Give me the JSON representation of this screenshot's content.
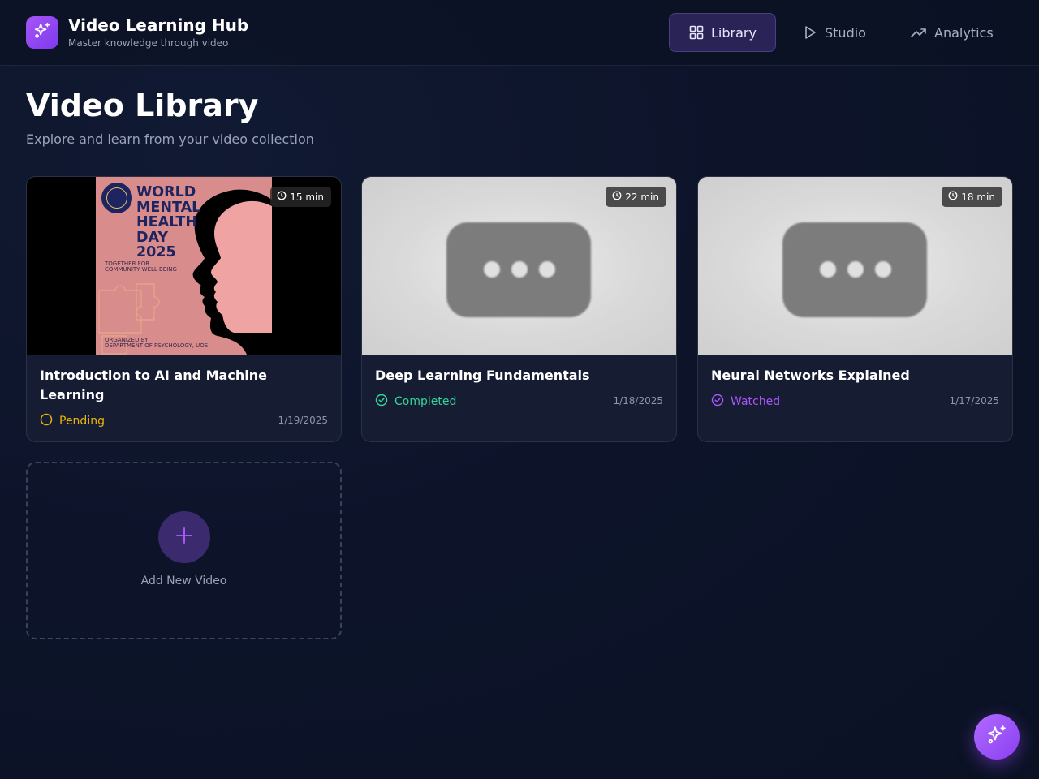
{
  "app": {
    "title": "Video Learning Hub",
    "subtitle": "Master knowledge through video",
    "logo_icon": "sparkles-icon"
  },
  "nav": [
    {
      "label": "Library",
      "icon": "grid-icon",
      "active": true
    },
    {
      "label": "Studio",
      "icon": "play-icon",
      "active": false
    },
    {
      "label": "Analytics",
      "icon": "trending-up-icon",
      "active": false
    }
  ],
  "page": {
    "title": "Video Library",
    "subtitle": "Explore and learn from your video collection"
  },
  "videos": [
    {
      "title": "Introduction to AI and Machine Learning",
      "duration": "15 min",
      "status": "Pending",
      "status_color": "#eab308",
      "date": "1/19/2025",
      "thumbnail": {
        "kind": "poster",
        "lines": [
          "WORLD",
          "MENTAL",
          "HEALTH",
          "DAY",
          "2025"
        ],
        "tagline": [
          "TOGETHER FOR",
          "COMMUNITY WELL-BEING"
        ],
        "organizer": [
          "ORGANIZED BY",
          "DEPARTMENT OF PSYCHOLOGY, UOS"
        ]
      }
    },
    {
      "title": "Deep Learning Fundamentals",
      "duration": "22 min",
      "status": "Completed",
      "status_color": "#34d399",
      "date": "1/18/2025",
      "thumbnail": {
        "kind": "placeholder"
      }
    },
    {
      "title": "Neural Networks Explained",
      "duration": "18 min",
      "status": "Watched",
      "status_color": "#a855f7",
      "date": "1/17/2025",
      "thumbnail": {
        "kind": "placeholder"
      }
    }
  ],
  "add_card": {
    "label": "Add New Video",
    "icon": "plus-icon"
  },
  "fab": {
    "icon": "sparkles-icon"
  },
  "colors": {
    "accent": "#8b5cf6",
    "active_nav_bg": "#2a2355",
    "card_bg": "#161d33"
  }
}
